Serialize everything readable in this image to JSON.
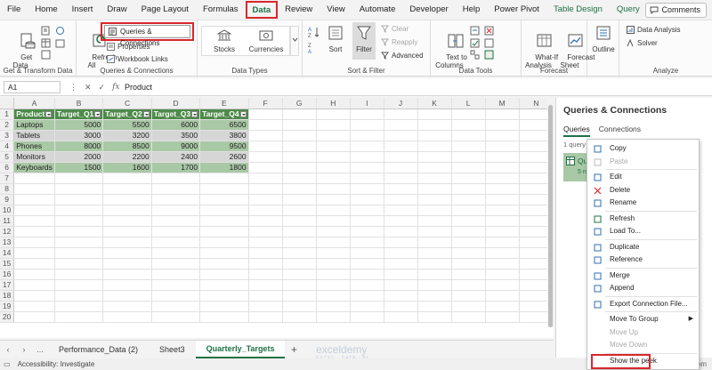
{
  "menu": {
    "tabs": [
      "File",
      "Home",
      "Insert",
      "Draw",
      "Page Layout",
      "Formulas",
      "Data",
      "Review",
      "View",
      "Automate",
      "Developer",
      "Help",
      "Power Pivot",
      "Table Design",
      "Query"
    ],
    "active": "Data",
    "comments_label": "Comments"
  },
  "ribbon": {
    "get_data": "Get\nData",
    "get_transform_label": "Get & Transform Data",
    "refresh_all": "Refresh\nAll",
    "queries_connections": "Queries & Connections",
    "properties": "Properties",
    "workbook_links": "Workbook Links",
    "qc_group_label": "Queries & Connections",
    "stocks": "Stocks",
    "currencies": "Currencies",
    "data_types_label": "Data Types",
    "sort": "Sort",
    "filter": "Filter",
    "clear": "Clear",
    "reapply": "Reapply",
    "advanced": "Advanced",
    "sort_filter_label": "Sort & Filter",
    "text_to_columns": "Text to\nColumns",
    "data_tools_label": "Data Tools",
    "what_if": "What-If\nAnalysis",
    "forecast_sheet": "Forecast\nSheet",
    "forecast_label": "Forecast",
    "outline": "Outline",
    "data_analysis": "Data Analysis",
    "solver": "Solver",
    "analyze_label": "Analyze"
  },
  "formula_bar": {
    "name_box": "A1",
    "formula": "Product"
  },
  "grid": {
    "columns": [
      "A",
      "B",
      "C",
      "D",
      "E",
      "F",
      "G",
      "H",
      "I",
      "J",
      "K",
      "L",
      "M",
      "N"
    ],
    "headers": [
      "Product",
      "Target_Q1",
      "Target_Q2",
      "Target_Q3",
      "Target_Q4"
    ],
    "rows": [
      [
        "Laptops",
        "5000",
        "5500",
        "6000",
        "6500"
      ],
      [
        "Tablets",
        "3000",
        "3200",
        "3500",
        "3800"
      ],
      [
        "Phones",
        "8000",
        "8500",
        "9000",
        "9500"
      ],
      [
        "Monitors",
        "2000",
        "2200",
        "2400",
        "2600"
      ],
      [
        "Keyboards",
        "1500",
        "1600",
        "1700",
        "1800"
      ]
    ],
    "row_numbers": [
      "1",
      "2",
      "3",
      "4",
      "5",
      "6",
      "7",
      "8",
      "9",
      "10",
      "11",
      "12",
      "13",
      "14",
      "15",
      "16",
      "17",
      "18",
      "19",
      "20"
    ]
  },
  "sheets": {
    "more": "...",
    "tabs": [
      "Performance_Data (2)",
      "Sheet3",
      "Quarterly_Targets"
    ],
    "active": "Quarterly_Targets"
  },
  "status": {
    "accessibility": "Accessibility: Investigate",
    "watermark": "exceldemy",
    "watermark_sub": "EXCEL · DATA · BI",
    "site": "wsxdn.com"
  },
  "pane": {
    "title": "Queries & Connections",
    "tabs": [
      "Queries",
      "Connections"
    ],
    "count": "1 query",
    "item_name": "Qu",
    "item_sub": "5 ro"
  },
  "context_menu": {
    "items": [
      {
        "label": "Copy",
        "disabled": false
      },
      {
        "label": "Paste",
        "disabled": true
      },
      {
        "label": "Edit",
        "disabled": false
      },
      {
        "label": "Delete",
        "disabled": false
      },
      {
        "label": "Rename",
        "disabled": false
      },
      {
        "label": "Refresh",
        "disabled": false
      },
      {
        "label": "Load To...",
        "disabled": false
      },
      {
        "label": "Duplicate",
        "disabled": false
      },
      {
        "label": "Reference",
        "disabled": false
      },
      {
        "label": "Merge",
        "disabled": false
      },
      {
        "label": "Append",
        "disabled": false
      },
      {
        "label": "Export Connection File...",
        "disabled": false
      },
      {
        "label": "Move To Group",
        "disabled": false
      },
      {
        "label": "Move Up",
        "disabled": true
      },
      {
        "label": "Move Down",
        "disabled": true
      },
      {
        "label": "Show the peek",
        "disabled": false
      },
      {
        "label": "Properties...",
        "disabled": false
      }
    ]
  },
  "colors": {
    "accent": "#1e7145",
    "highlight_red": "#d9262c",
    "table_header": "#4e8a4a",
    "band_green": "#a9c8a5",
    "band_gray": "#d6d6d6"
  }
}
